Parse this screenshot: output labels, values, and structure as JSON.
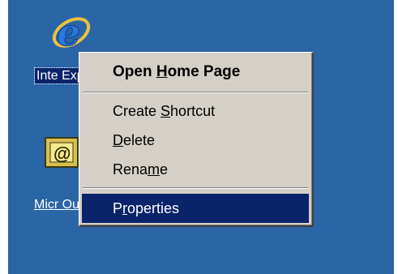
{
  "desktop": {
    "background_color": "#2a65a5",
    "icons": [
      {
        "name": "internet-explorer-icon",
        "label": "Inte Exp"
      },
      {
        "name": "outlook-icon",
        "label": "Micr Outlook"
      }
    ]
  },
  "context_menu": {
    "items": [
      {
        "pre": "Open ",
        "key": "H",
        "post": "ome Page",
        "default": true
      },
      {
        "pre": "Create ",
        "key": "S",
        "post": "hortcut"
      },
      {
        "pre": "",
        "key": "D",
        "post": "elete"
      },
      {
        "pre": "Rena",
        "key": "m",
        "post": "e"
      },
      {
        "pre": "P",
        "key": "r",
        "post": "operties",
        "selected": true
      }
    ],
    "selection_color": "#0a246a"
  }
}
